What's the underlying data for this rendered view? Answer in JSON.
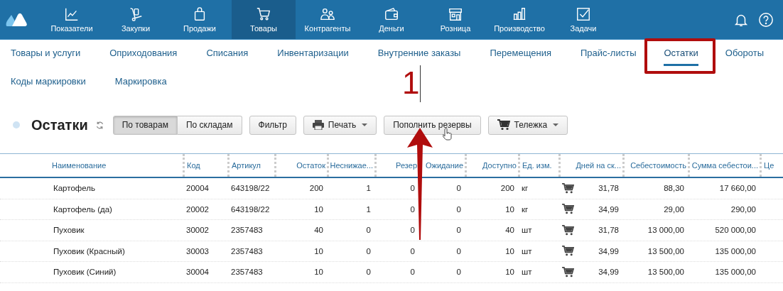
{
  "top_nav": {
    "items": [
      {
        "label": "Показатели",
        "selected": false
      },
      {
        "label": "Закупки",
        "selected": false
      },
      {
        "label": "Продажи",
        "selected": false
      },
      {
        "label": "Товары",
        "selected": true
      },
      {
        "label": "Контрагенты",
        "selected": false
      },
      {
        "label": "Деньги",
        "selected": false
      },
      {
        "label": "Розница",
        "selected": false
      },
      {
        "label": "Производство",
        "selected": false
      },
      {
        "label": "Задачи",
        "selected": false
      }
    ]
  },
  "sub_nav": {
    "rows": [
      [
        {
          "label": "Товары и услуги",
          "selected": false
        },
        {
          "label": "Оприходования",
          "selected": false
        },
        {
          "label": "Списания",
          "selected": false
        },
        {
          "label": "Инвентаризации",
          "selected": false
        },
        {
          "label": "Внутренние заказы",
          "selected": false
        },
        {
          "label": "Перемещения",
          "selected": false
        },
        {
          "label": "Прайс-листы",
          "selected": false
        },
        {
          "label": "Остатки",
          "selected": true
        },
        {
          "label": "Обороты",
          "selected": false
        }
      ],
      [
        {
          "label": "Коды маркировки",
          "selected": false
        },
        {
          "label": "Маркировка",
          "selected": false
        }
      ]
    ]
  },
  "toolbar": {
    "title": "Остатки",
    "view_toggle": [
      {
        "label": "По товарам",
        "selected": true
      },
      {
        "label": "По складам",
        "selected": false
      }
    ],
    "buttons": [
      {
        "label": "Фильтр",
        "kind": "plain"
      },
      {
        "label": "Печать",
        "kind": "menu"
      },
      {
        "label": "Пополнить резервы",
        "kind": "plain"
      },
      {
        "label": "Тележка",
        "kind": "menu"
      }
    ]
  },
  "table": {
    "columns": [
      {
        "label": "Наименование",
        "kind": "text"
      },
      {
        "label": "Код",
        "kind": "text"
      },
      {
        "label": "Артикул",
        "kind": "text"
      },
      {
        "label": "Остаток",
        "kind": "number"
      },
      {
        "label": "Неснижае...",
        "kind": "number"
      },
      {
        "label": "Резер",
        "kind": "number"
      },
      {
        "label": "Ожидание",
        "kind": "number"
      },
      {
        "label": "Доступно",
        "kind": "number"
      },
      {
        "label": "Ед. изм.",
        "kind": "text"
      },
      {
        "label": "Дней на ск...",
        "kind": "cart_number"
      },
      {
        "label": "Себестоимость",
        "kind": "number"
      },
      {
        "label": "Сумма себестои...",
        "kind": "number"
      },
      {
        "label": "Це",
        "kind": "text"
      }
    ],
    "rows": [
      [
        "Картофель",
        "20004",
        "643198/22",
        "200",
        "1",
        "0",
        "0",
        "200",
        "кг",
        "31,78",
        "88,30",
        "17 660,00"
      ],
      [
        "Картофель (да)",
        "20002",
        "643198/22",
        "10",
        "1",
        "0",
        "0",
        "10",
        "кг",
        "34,99",
        "29,00",
        "290,00"
      ],
      [
        "Пуховик",
        "30002",
        "2357483",
        "40",
        "0",
        "0",
        "0",
        "40",
        "шт",
        "31,78",
        "13 000,00",
        "520 000,00"
      ],
      [
        "Пуховик (Красный)",
        "30003",
        "2357483",
        "10",
        "0",
        "0",
        "0",
        "10",
        "шт",
        "34,99",
        "13 500,00",
        "135 000,00"
      ],
      [
        "Пуховик (Синий)",
        "30004",
        "2357483",
        "10",
        "0",
        "0",
        "0",
        "10",
        "шт",
        "34,99",
        "13 500,00",
        "135 000,00"
      ]
    ]
  },
  "annotation": {
    "step_label": "1"
  }
}
